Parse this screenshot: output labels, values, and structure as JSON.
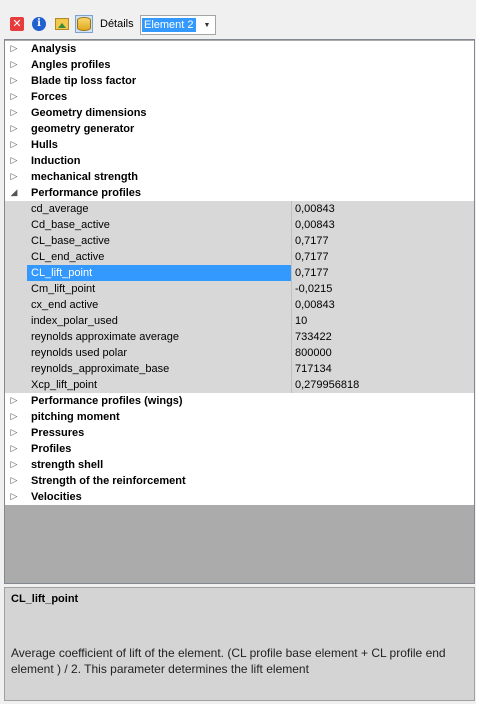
{
  "toolbar": {
    "icons": [
      "close-icon",
      "info-icon",
      "image-icon",
      "database-icon"
    ],
    "details_label": "Détails",
    "element_select": {
      "value": "Element 2"
    }
  },
  "grid": {
    "categories_before": [
      {
        "label": "Analysis",
        "expanded": false
      },
      {
        "label": "Angles profiles",
        "expanded": false
      },
      {
        "label": "Blade tip loss factor",
        "expanded": false
      },
      {
        "label": "Forces",
        "expanded": false
      },
      {
        "label": "Geometry dimensions",
        "expanded": false
      },
      {
        "label": "geometry generator",
        "expanded": false
      },
      {
        "label": "Hulls",
        "expanded": false
      },
      {
        "label": "Induction",
        "expanded": false
      },
      {
        "label": "mechanical strength",
        "expanded": false
      }
    ],
    "expanded_category": {
      "label": "Performance profiles",
      "properties": [
        {
          "name": "cd_average",
          "value": "0,00843"
        },
        {
          "name": "Cd_base_active",
          "value": "0,00843"
        },
        {
          "name": "CL_base_active",
          "value": "0,7177"
        },
        {
          "name": "CL_end_active",
          "value": "0,7177"
        },
        {
          "name": "CL_lift_point",
          "value": "0,7177",
          "selected": true
        },
        {
          "name": "Cm_lift_point",
          "value": "-0,0215"
        },
        {
          "name": "cx_end active",
          "value": "0,00843"
        },
        {
          "name": "index_polar_used",
          "value": "10"
        },
        {
          "name": "reynolds approximate average",
          "value": "733422"
        },
        {
          "name": "reynolds used polar",
          "value": "800000"
        },
        {
          "name": "reynolds_approximate_base",
          "value": "717134"
        },
        {
          "name": "Xcp_lift_point",
          "value": "0,279956818"
        }
      ]
    },
    "categories_after": [
      {
        "label": "Performance profiles (wings)",
        "expanded": false
      },
      {
        "label": "pitching moment",
        "expanded": false
      },
      {
        "label": "Pressures",
        "expanded": false
      },
      {
        "label": "Profiles",
        "expanded": false
      },
      {
        "label": "strength  shell",
        "expanded": false
      },
      {
        "label": "Strength of the reinforcement",
        "expanded": false
      },
      {
        "label": "Velocities",
        "expanded": false
      }
    ]
  },
  "description": {
    "title": "CL_lift_point",
    "text": "Average coefficient of lift of the element. (CL profile base element + CL profile end element ) / 2. This parameter determines the lift element"
  },
  "colors": {
    "selection": "#3399ff",
    "property_background": "#d8d8d8",
    "empty_area": "#ababab"
  }
}
